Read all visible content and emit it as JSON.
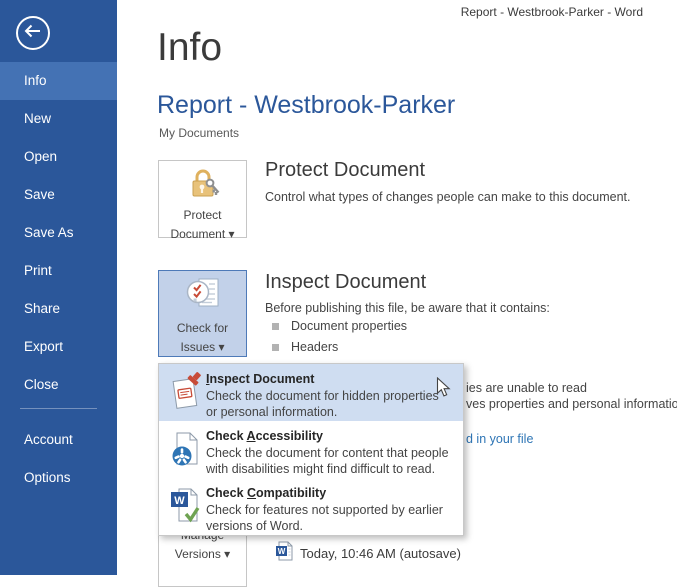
{
  "window_title": "Report - Westbrook-Parker - Word",
  "colors": {
    "sidebar_bg": "#2b579a",
    "sidebar_active_bg": "#4472b4",
    "accent_blue": "#2b579a",
    "issues_button_bg": "#c2d1e9",
    "issues_button_border": "#4e7ab8",
    "menu_selected_bg": "#cfddf1",
    "link_blue": "#2e75b5"
  },
  "sidebar": {
    "back_icon": "back-arrow-icon",
    "items": [
      "Info",
      "New",
      "Open",
      "Save",
      "Save As",
      "Print",
      "Share",
      "Export",
      "Close"
    ],
    "active_item": "Info",
    "footer_items": [
      "Account",
      "Options"
    ]
  },
  "page": {
    "heading": "Info",
    "document_title": "Report - Westbrook-Parker",
    "document_location": "My Documents"
  },
  "protect_section": {
    "button": {
      "icon": "lock-key-icon",
      "line1": "Protect",
      "line2": "Document ▾"
    },
    "heading": "Protect Document",
    "description": "Control what types of changes people can make to this document."
  },
  "inspect_section": {
    "button": {
      "icon": "check-issues-icon",
      "line1": "Check for",
      "line2": "Issues ▾"
    },
    "heading": "Inspect Document",
    "description": "Before publishing this file, be aware that it contains:",
    "bullets": [
      "Document properties",
      "Headers"
    ]
  },
  "background_fragments": {
    "bullet_fragment_1": "ies are unable to read",
    "bullet_fragment_2": "ves properties and personal information",
    "link_fragment": "d in your file"
  },
  "issues_menu": {
    "items": [
      {
        "icon": "inspect-document-stamp-icon",
        "title_pre": "",
        "title_accel": "I",
        "title_post": "nspect Document",
        "desc_line1": "Check the document for hidden properties",
        "desc_line2": "or personal information.",
        "selected": true
      },
      {
        "icon": "check-accessibility-icon",
        "title_pre": "Check ",
        "title_accel": "A",
        "title_post": "ccessibility",
        "desc_line1": "Check the document for content that people",
        "desc_line2": "with disabilities might find difficult to read.",
        "selected": false
      },
      {
        "icon": "check-compatibility-icon",
        "title_pre": "Check ",
        "title_accel": "C",
        "title_post": "ompatibility",
        "desc_line1": "Check for features not supported by earlier",
        "desc_line2": "versions of Word.",
        "selected": false
      }
    ]
  },
  "versions_section": {
    "button": {
      "icon": "manage-versions-icon",
      "line1": "Manage",
      "line2": "Versions ▾"
    },
    "entry": {
      "icon": "word-file-icon",
      "label": "Today, 10:46 AM (autosave)"
    }
  },
  "cursor_icon": "mouse-pointer-icon"
}
